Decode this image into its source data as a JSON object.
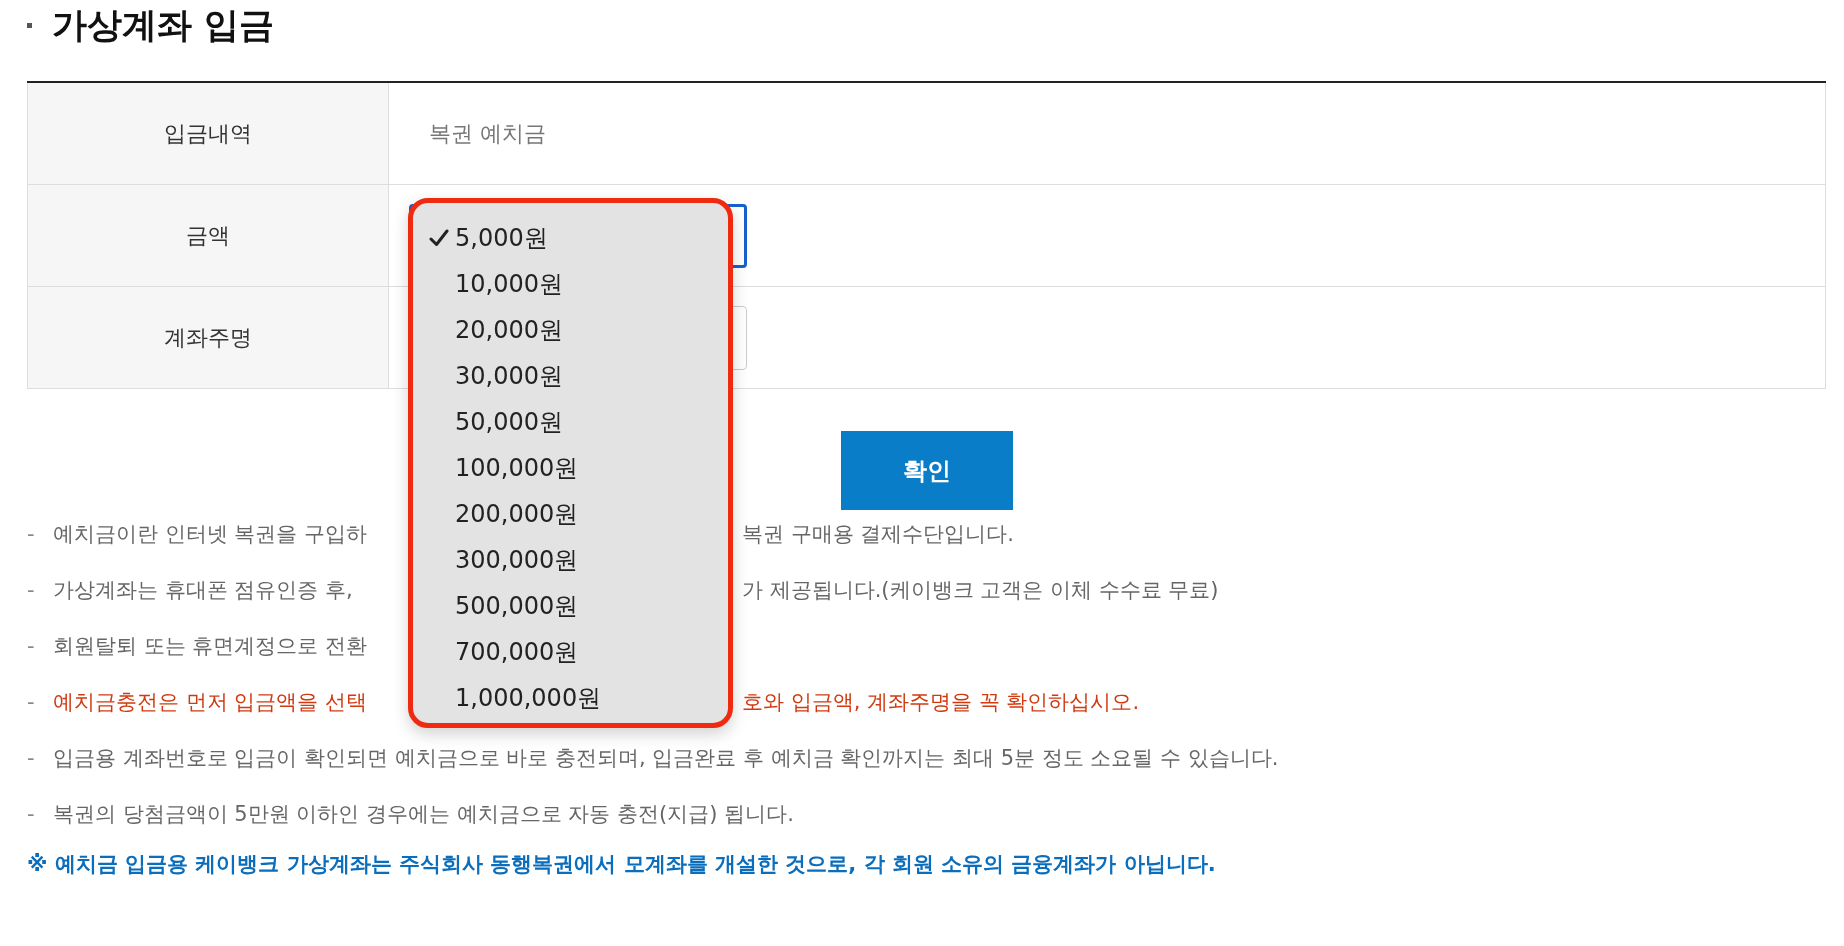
{
  "title": "가상계좌 입금",
  "form": {
    "rows": [
      {
        "kind": "text",
        "label": "입금내역",
        "value": "복권 예치금"
      },
      {
        "kind": "select",
        "label": "금액"
      },
      {
        "kind": "input",
        "label": "계좌주명"
      }
    ]
  },
  "dropdown": {
    "options": [
      {
        "label": "5,000원",
        "selected": true
      },
      {
        "label": "10,000원",
        "selected": false
      },
      {
        "label": "20,000원",
        "selected": false
      },
      {
        "label": "30,000원",
        "selected": false
      },
      {
        "label": "50,000원",
        "selected": false
      },
      {
        "label": "100,000원",
        "selected": false
      },
      {
        "label": "200,000원",
        "selected": false
      },
      {
        "label": "300,000원",
        "selected": false
      },
      {
        "label": "500,000원",
        "selected": false
      },
      {
        "label": "700,000원",
        "selected": false
      },
      {
        "label": "1,000,000원",
        "selected": false
      }
    ]
  },
  "confirm_button": "확인",
  "notes": [
    {
      "marker": "-",
      "emphasis": false,
      "segments": [
        "예치금이란 인터넷 복권을 구입하",
        "복권 구매용 결제수단입니다."
      ]
    },
    {
      "marker": "-",
      "emphasis": false,
      "segments": [
        "가상계좌는 휴대폰 점유인증 후,",
        "가 제공됩니다.(케이뱅크 고객은 이체 수수료 무료)"
      ]
    },
    {
      "marker": "-",
      "emphasis": false,
      "segments": [
        "회원탈퇴 또는 휴면계정으로 전환"
      ]
    },
    {
      "marker": "-",
      "emphasis": true,
      "segments": [
        "예치금충전은 먼저 입금액을 선택",
        "호와 입금액, 계좌주명을 꼭 확인하십시오."
      ]
    },
    {
      "marker": "-",
      "emphasis": false,
      "segments": [
        "입금용 계좌번호로 입금이 확인되면 예치금으로 바로 충전되며, 입금완료 후 예치금 확인까지는 최대 5분 정도 소요될 수 있습니다."
      ]
    },
    {
      "marker": "-",
      "emphasis": false,
      "segments": [
        "복권의 당첨금액이 5만원 이하인 경우에는 예치금으로 자동 충전(지급) 됩니다."
      ]
    }
  ],
  "footnote": "※ 예치금 입금용 케이뱅크 가상계좌는 주식회사 동행복권에서 모계좌를 개설한 것으로, 각 회원 소유의 금융계좌가 아닙니다."
}
